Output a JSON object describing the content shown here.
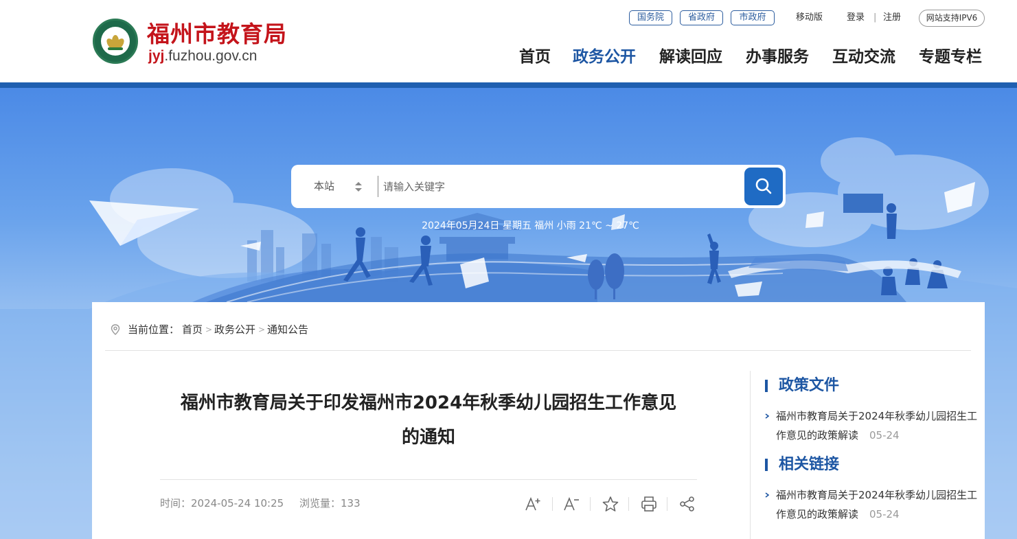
{
  "header": {
    "site_title": "福州市教育局",
    "domain_highlight": "jyj",
    "domain_rest": ".fuzhou.gov.cn",
    "emblem_text_top": "FUZHOU EDUCATION",
    "emblem_text_bottom": "福州教育",
    "gov_links": [
      "国务院",
      "省政府",
      "市政府"
    ],
    "mobile": "移动版",
    "login": "登录",
    "separator": "|",
    "register": "注册",
    "ipv6": "网站支持IPV6",
    "nav": [
      "首页",
      "政务公开",
      "解读回应",
      "办事服务",
      "互动交流",
      "专题专栏"
    ],
    "nav_active_index": 1,
    "colors": {
      "brand_red": "#c4141b",
      "brand_blue": "#1d56a3"
    }
  },
  "banner": {
    "weather": "2024年05月24日  星期五 福州 小雨 21℃ ~ 27℃",
    "search": {
      "scope": "本站",
      "placeholder": "请输入关键字",
      "button_icon": "search-icon"
    }
  },
  "breadcrumb": {
    "icon": "location-pin-icon",
    "label": "当前位置：",
    "items": [
      "首页",
      "政务公开",
      "通知公告"
    ],
    "separator": ">"
  },
  "article": {
    "title_line1": "福州市教育局关于印发福州市2024年秋季幼儿园招生工作意见",
    "title_line2": "的通知",
    "time_label": "时间：2024-05-24 10:25",
    "views_label": "浏览量：133",
    "tools": [
      "font-increase-icon",
      "font-decrease-icon",
      "star-icon",
      "print-icon",
      "share-icon"
    ]
  },
  "sidebar": {
    "sections": [
      {
        "heading": "政策文件",
        "items": [
          {
            "text": "福州市教育局关于2024年秋季幼儿园招生工作意见的政策解读",
            "date": "05-24"
          }
        ]
      },
      {
        "heading": "相关链接",
        "items": [
          {
            "text": "福州市教育局关于2024年秋季幼儿园招生工作意见的政策解读",
            "date": "05-24"
          }
        ]
      }
    ]
  }
}
